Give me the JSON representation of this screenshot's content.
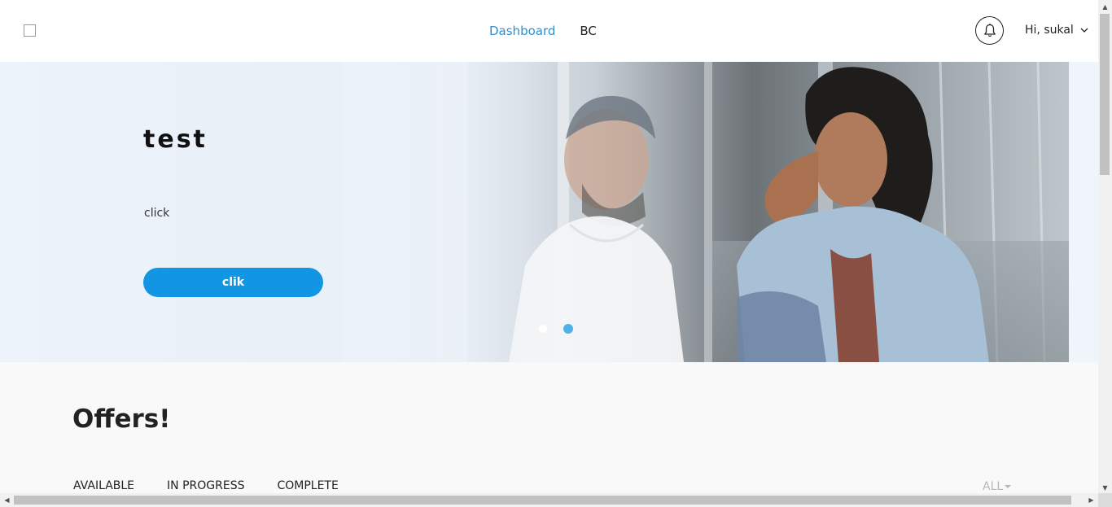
{
  "header": {
    "nav": [
      {
        "label": "Dashboard",
        "active": true
      },
      {
        "label": "BC",
        "active": false
      }
    ],
    "user_greeting": "Hi, sukal"
  },
  "hero": {
    "title": "test",
    "subtitle": "click",
    "button_label": "clik",
    "slides": 2,
    "active_slide": 2
  },
  "offers": {
    "title": "Offers!",
    "tabs": [
      "AVAILABLE",
      "IN PROGRESS",
      "COMPLETE"
    ],
    "filter": "ALL"
  },
  "colors": {
    "accent": "#1296e3",
    "nav_active": "#2e8fd0",
    "dot_active": "#4fb1e6"
  },
  "icons": {
    "notification": "bell-icon",
    "user_dropdown": "chevron-down-icon",
    "filter_dropdown": "caret-down-icon"
  }
}
